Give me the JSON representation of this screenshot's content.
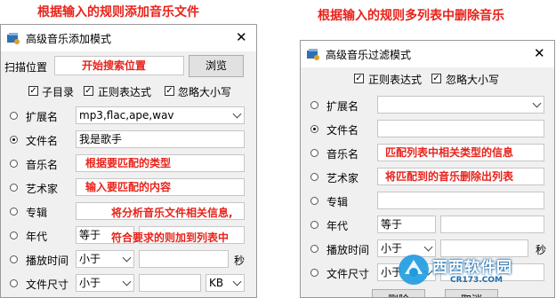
{
  "headings": {
    "left": "根据输入的规则添加音乐文件",
    "right": "根据输入的规则多列表中删除音乐"
  },
  "left_window": {
    "title": "高级音乐添加模式",
    "close_label": "✕",
    "scan_label": "扫描位置",
    "scan_value": "开始搜索位置",
    "browse_button": "浏览",
    "check_subdir": "子目录",
    "check_regex": "正则表达式",
    "check_ignorecase": "忽略大小写",
    "rows": {
      "ext_label": "扩展名",
      "ext_value": "mp3,flac,ape,wav",
      "filename_label": "文件名",
      "filename_value": "我是歌手",
      "music_label": "音乐名",
      "music_hint": "根据要匹配的类型",
      "artist_label": "艺术家",
      "artist_hint": "输入要匹配的内容",
      "album_label": "专辑",
      "year_label": "年代",
      "year_op": "等于",
      "playtime_label": "播放时间",
      "playtime_op": "小于",
      "playtime_unit": "秒",
      "filesize_label": "文件尺寸",
      "filesize_op": "小于",
      "filesize_unit": "KB"
    },
    "overlay_line1": "将分析音乐文件相关信息,",
    "overlay_line2": "符合要求的则加到列表中"
  },
  "right_window": {
    "title": "高级音乐过滤模式",
    "close_label": "✕",
    "check_regex": "正则表达式",
    "check_ignorecase": "忽略大小写",
    "rows": {
      "ext_label": "扩展名",
      "filename_label": "文件名",
      "music_label": "音乐名",
      "music_hint": "匹配列表中相关类型的信息",
      "artist_label": "艺术家",
      "artist_hint": "将匹配到的音乐删除出列表",
      "album_label": "专辑",
      "year_label": "年代",
      "year_op": "等于",
      "playtime_label": "播放时间",
      "playtime_op": "小于",
      "playtime_unit": "秒",
      "filesize_label": "文件尺寸",
      "filesize_op": "小于"
    },
    "delete_button": "删除",
    "cancel_button": "取消"
  },
  "watermark": {
    "text": "西西软件园",
    "url": "CR173.COM"
  }
}
